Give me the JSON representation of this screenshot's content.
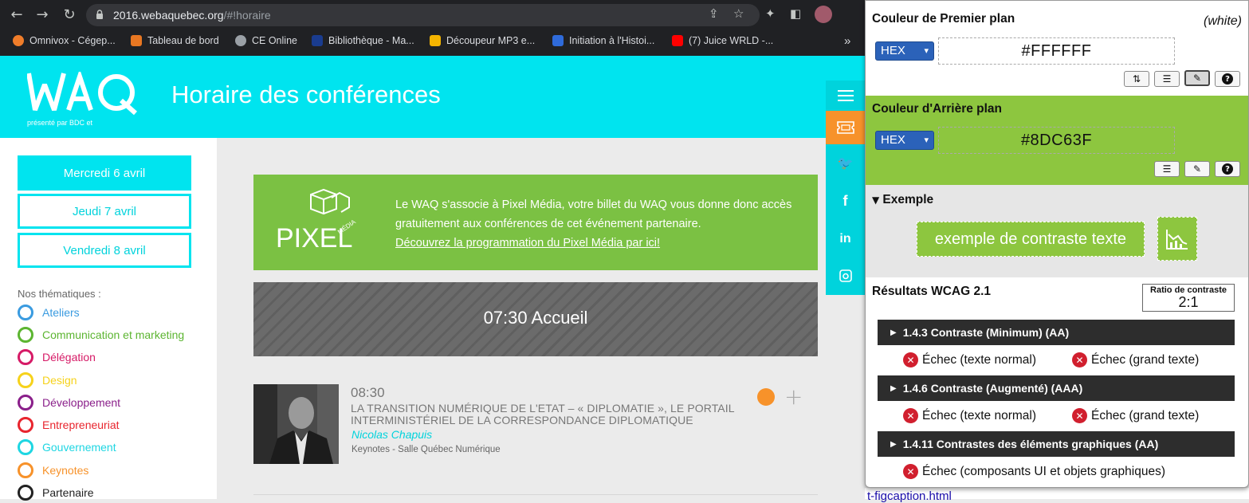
{
  "browser": {
    "url_domain": "2016.webaquebec.org",
    "url_path": "/#!horaire",
    "bookmarks": [
      {
        "label": "Omnivox - Cégep...",
        "color": "#f07d2a"
      },
      {
        "label": "Tableau de bord",
        "color": "#e87722"
      },
      {
        "label": "CE Online",
        "color": "#9aa0a6"
      },
      {
        "label": "Bibliothèque - Ma...",
        "color": "#1a3c8f"
      },
      {
        "label": "Découpeur MP3 e...",
        "color": "#f4b400"
      },
      {
        "label": "Initiation à l'Histoi...",
        "color": "#2f6bdb"
      },
      {
        "label": "(7) Juice WRLD -...",
        "color": "#ff0000"
      }
    ],
    "more_bookmarks": "»"
  },
  "site": {
    "logo_text": "WAQ",
    "logo_subtext": "présenté par",
    "page_title": "Horaire des conférences",
    "accent": "#00e4ef"
  },
  "sidebar": {
    "days": [
      {
        "label": "Mercredi 6 avril",
        "active": true
      },
      {
        "label": "Jeudi 7 avril",
        "active": false
      },
      {
        "label": "Vendredi 8 avril",
        "active": false
      }
    ],
    "themes_label": "Nos thématiques :",
    "themes": [
      {
        "label": "Ateliers",
        "color": "#3a9be0"
      },
      {
        "label": "Communication et marketing",
        "color": "#5cb531"
      },
      {
        "label": "Délégation",
        "color": "#d61a66"
      },
      {
        "label": "Design",
        "color": "#f6d21b"
      },
      {
        "label": "Développement",
        "color": "#8a1f8a"
      },
      {
        "label": "Entrepreneuriat",
        "color": "#e8252e"
      },
      {
        "label": "Gouvernement",
        "color": "#1ed6e2"
      },
      {
        "label": "Keynotes",
        "color": "#f7922a"
      },
      {
        "label": "Partenaire",
        "color": "#222222"
      }
    ]
  },
  "promo": {
    "logo_text": "PIXEL",
    "logo_sub": "MÉDIA",
    "text": "Le WAQ s'associe à Pixel Média, votre billet du WAQ vous donne donc accès gratuitement aux conférences de cet événement partenaire.",
    "link": "Découvrez la programmation du Pixel Média par ici!"
  },
  "schedule": {
    "accueil": "07:30 Accueil",
    "talk": {
      "time": "08:30",
      "title": "LA TRANSITION NUMÉRIQUE DE L'ETAT – « DIPLOMATIE », LE PORTAIL INTERMINISTÉRIEL DE LA CORRESPONDANCE DIPLOMATIQUE",
      "speaker": "Nicolas Chapuis",
      "room": "Keynotes - Salle Québec Numérique",
      "plus": "+"
    }
  },
  "panel": {
    "fg_title": "Couleur de Premier plan",
    "fg_note": "(white)",
    "fg_format": "HEX",
    "fg_value": "#FFFFFF",
    "bg_title": "Couleur d'Arrière plan",
    "bg_format": "HEX",
    "bg_value": "#8DC63F",
    "example_title": "Exemple",
    "example_text": "exemple de contraste texte",
    "results_title": "Résultats WCAG 2.1",
    "ratio_label": "Ratio de contraste",
    "ratio_value": "2:1",
    "criteria": [
      {
        "title": "1.4.3 Contraste (Minimum) (AA)",
        "results": [
          "Échec (texte normal)",
          "Échec (grand texte)"
        ]
      },
      {
        "title": "1.4.6 Contraste (Augmenté) (AAA)",
        "results": [
          "Échec (texte normal)",
          "Échec (grand texte)"
        ]
      },
      {
        "title": "1.4.11 Contrastes des éléments graphiques (AA)",
        "results": [
          "Échec (composants UI et objets graphiques)"
        ]
      }
    ],
    "below_link": "t-figcaption.html"
  }
}
